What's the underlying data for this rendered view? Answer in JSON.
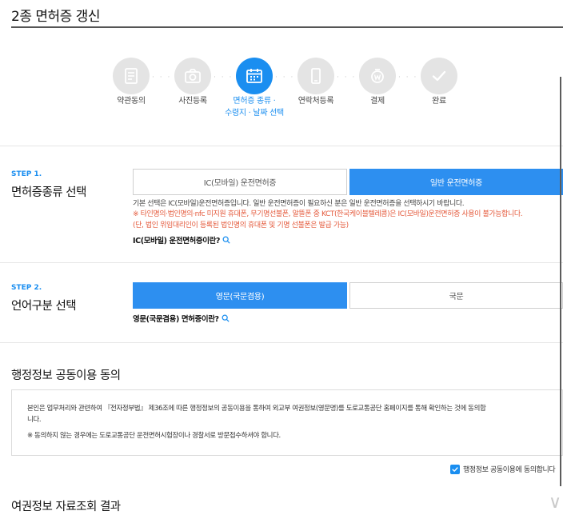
{
  "page": {
    "title": "2종 면허증 갱신"
  },
  "stepper": {
    "steps": [
      {
        "label": "약관동의",
        "icon": "document-icon",
        "active": false
      },
      {
        "label": "사진등록",
        "icon": "camera-icon",
        "active": false
      },
      {
        "label": "면허증 종류 ·",
        "label2": "수령지 · 날짜 선택",
        "icon": "calendar-icon",
        "active": true
      },
      {
        "label": "연락처등록",
        "icon": "phone-icon",
        "active": false
      },
      {
        "label": "결제",
        "icon": "payment-icon",
        "active": false
      },
      {
        "label": "완료",
        "icon": "check-icon",
        "active": false
      }
    ],
    "dots": "· · ·"
  },
  "step1": {
    "tag": "STEP 1.",
    "heading": "면허증종류 선택",
    "options": [
      "IC(모바일) 운전면허증",
      "일반 운전면허증"
    ],
    "selected_index": 1,
    "note1": "기본 선택은 IC(모바일)운전면허증입니다. 일반 운전면허증이 필요하신 분은 일반 운전면허증을 선택하시기 바랍니다.",
    "note2": "※ 타인명의·법인명의·nfc 미지원 휴대폰, 무기명선불폰, 알뜰폰 중 KCT(한국케이블텔레콤)은 IC(모바일)운전면허증 사용이 불가능합니다.",
    "note3": "(단, 법인 위임대리인이 등록된 법인명의 휴대폰 및 기명 선불폰은 발급 가능)",
    "help": "IC(모바일) 운전면허증이란?"
  },
  "step2": {
    "tag": "STEP 2.",
    "heading": "언어구분 선택",
    "options": [
      "영문(국문겸용)",
      "국문"
    ],
    "selected_index": 0,
    "help": "영문(국문겸용) 면허증이란?"
  },
  "consent": {
    "title": "행정정보 공동이용 동의",
    "line1": "본인은 업무처리와 관련하여 『전자정부법』 제36조에 따른 행정정보의 공동이용을 통하여 외교부 여권정보(영문명)를 도로교통공단 홈페이지를 통해 확인하는 것에 동의합",
    "line2": "니다.",
    "line3": "※ 동의하지 않는 경우에는 도로교통공단 운전면허시험장이나 경찰서로 방문접수하셔야 합니다.",
    "agree_label": "행정정보 공동이용에 동의합니다",
    "agreed": true
  },
  "result": {
    "title": "여권정보 자료조회 결과"
  },
  "colors": {
    "accent": "#1a8ef0",
    "warning": "#e4593b",
    "inactive_step": "#e4e4e4"
  }
}
